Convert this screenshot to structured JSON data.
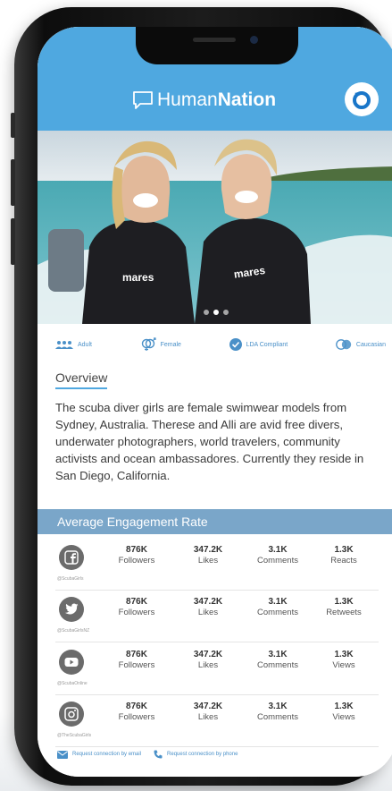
{
  "header": {
    "brand_light": "Human",
    "brand_bold": "Nation"
  },
  "carousel": {
    "active_index": 1,
    "count": 3
  },
  "attributes": [
    {
      "label": "Adult",
      "icon": "group-icon"
    },
    {
      "label": "Female",
      "icon": "gender-icon"
    },
    {
      "label": "LDA Compliant",
      "icon": "check-circle-icon"
    },
    {
      "label": "Caucasian",
      "icon": "ethnicity-icon"
    }
  ],
  "overview": {
    "title": "Overview",
    "text": "The scuba diver girls are female swimwear models from Sydney, Australia. Therese and Alli are avid free divers, underwater photographers, world travelers, community activists and ocean ambassadores. Currently they reside in San Diego, California."
  },
  "engagement": {
    "title": "Average Engagement Rate",
    "rows": [
      {
        "network": "facebook",
        "icon": "facebook-icon",
        "handle": "@ScubaGirls",
        "stats": [
          {
            "value": "876K",
            "label": "Followers"
          },
          {
            "value": "347.2K",
            "label": "Likes"
          },
          {
            "value": "3.1K",
            "label": "Comments"
          },
          {
            "value": "1.3K",
            "label": "Reacts"
          }
        ]
      },
      {
        "network": "twitter",
        "icon": "twitter-icon",
        "handle": "@ScubaGirlsNZ",
        "stats": [
          {
            "value": "876K",
            "label": "Followers"
          },
          {
            "value": "347.2K",
            "label": "Likes"
          },
          {
            "value": "3.1K",
            "label": "Comments"
          },
          {
            "value": "1.3K",
            "label": "Retweets"
          }
        ]
      },
      {
        "network": "youtube",
        "icon": "youtube-icon",
        "handle": "@ScubaOnline",
        "stats": [
          {
            "value": "876K",
            "label": "Followers"
          },
          {
            "value": "347.2K",
            "label": "Likes"
          },
          {
            "value": "3.1K",
            "label": "Comments"
          },
          {
            "value": "1.3K",
            "label": "Views"
          }
        ]
      },
      {
        "network": "instagram",
        "icon": "instagram-icon",
        "handle": "@TheScubaGirls",
        "stats": [
          {
            "value": "876K",
            "label": "Followers"
          },
          {
            "value": "347.2K",
            "label": "Likes"
          },
          {
            "value": "3.1K",
            "label": "Comments"
          },
          {
            "value": "1.3K",
            "label": "Views"
          }
        ]
      }
    ]
  },
  "connect": {
    "email": "Request connection by email",
    "phone": "Request connection by phone"
  },
  "colors": {
    "header_blue": "#4fa8e0",
    "engagement_bar": "#7aa6c9",
    "accent_text": "#4a90c8"
  }
}
